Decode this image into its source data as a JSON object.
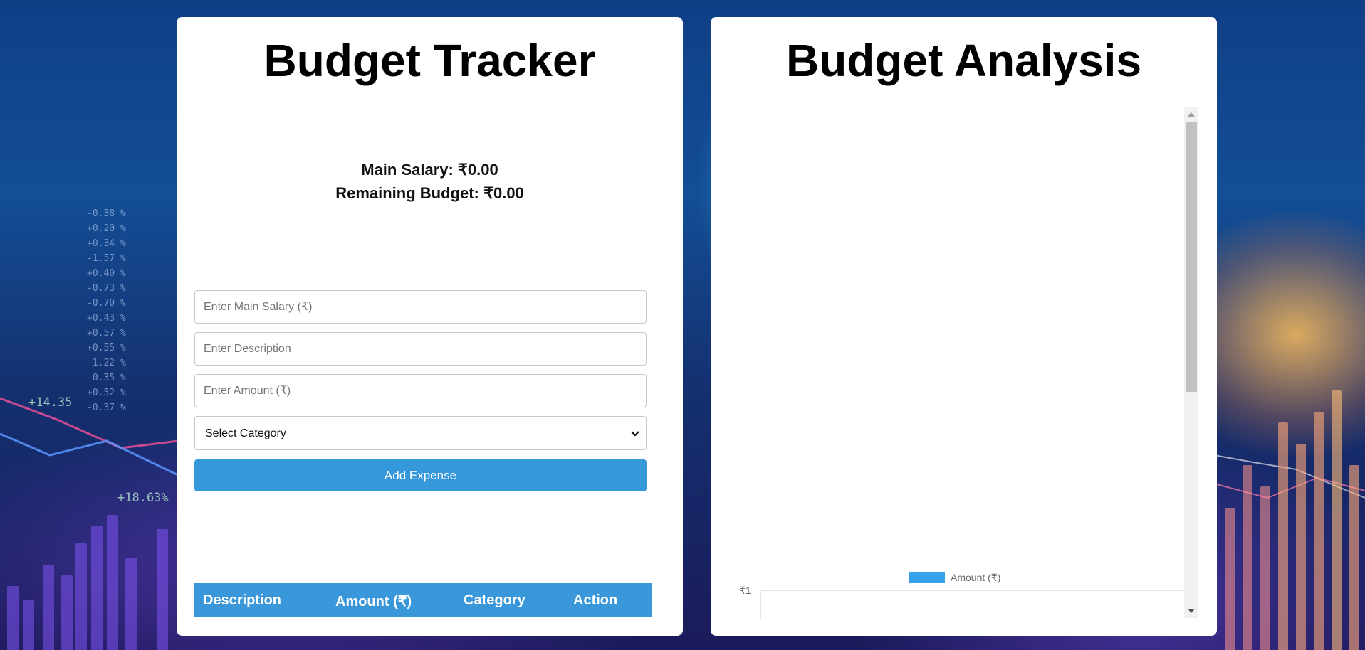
{
  "tracker": {
    "title": "Budget Tracker",
    "main_salary_label": "Main Salary: ₹0.00",
    "remaining_budget_label": "Remaining Budget: ₹0.00",
    "salary_placeholder": "Enter Main Salary (₹)",
    "description_placeholder": "Enter Description",
    "amount_placeholder": "Enter Amount (₹)",
    "category_selected": "Select Category",
    "add_button_label": "Add Expense",
    "table_headers": [
      "Description",
      "Amount (₹)",
      "Category",
      "Action"
    ]
  },
  "analysis": {
    "title": "Budget Analysis",
    "chart_data": {
      "type": "bar",
      "categories": [],
      "series": [
        {
          "name": "Amount (₹)",
          "values": []
        }
      ],
      "y_ticks": [
        "₹1"
      ],
      "legend_position": "top",
      "series_color": "#36a2eb"
    }
  },
  "colors": {
    "accent": "#3498db",
    "table_header": "#3a97d9",
    "panel_background": "#ffffff"
  }
}
